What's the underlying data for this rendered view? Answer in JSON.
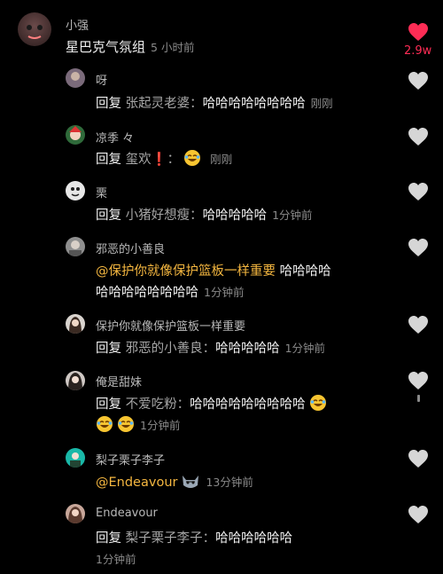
{
  "top_comment": {
    "username": "小强",
    "text": "星巴克气氛组",
    "time": "5 小时前",
    "likes": "2.9w"
  },
  "replies": [
    {
      "username": "呀",
      "reply_label": "回复",
      "target": "张起灵老婆：",
      "text": "哈哈哈哈哈哈哈哈",
      "time": "刚刚"
    },
    {
      "username": "凉季 々",
      "reply_label": "回复",
      "target": "玺欢",
      "exclam": "❗",
      "colon": "：",
      "time": "刚刚"
    },
    {
      "username": "栗",
      "reply_label": "回复",
      "target": "小猪好想瘦：",
      "text": "哈哈哈哈哈",
      "time": "1分钟前"
    },
    {
      "username": "邪恶的小善良",
      "mention": "@保护你就像保护篮板一样重要",
      "text_line1": "哈哈哈哈",
      "text_line2": "哈哈哈哈哈哈哈哈",
      "time": "1分钟前"
    },
    {
      "username": "保护你就像保护篮板一样重要",
      "reply_label": "回复",
      "target": "邪恶的小善良：",
      "text": "哈哈哈哈哈",
      "time": "1分钟前"
    },
    {
      "username": "俺是甜妹",
      "reply_label": "回复",
      "target": "不爱吃粉：",
      "text": "哈哈哈哈哈哈哈哈哈",
      "time": "1分钟前"
    },
    {
      "username": "梨子栗子李子",
      "mention": "@Endeavour",
      "time": "13分钟前"
    },
    {
      "username": "Endeavour",
      "reply_label": "回复",
      "target": "梨子栗子李子：",
      "text": "哈哈哈哈哈哈",
      "time": "1分钟前"
    }
  ],
  "colors": {
    "liked": "#fe2c55",
    "mention": "#f5b740",
    "heart_default": "#d6d6d6"
  },
  "icons": {
    "like": "heart-icon",
    "laugh": "laughing-emoji-icon",
    "cat": "cat-emoji-icon"
  }
}
